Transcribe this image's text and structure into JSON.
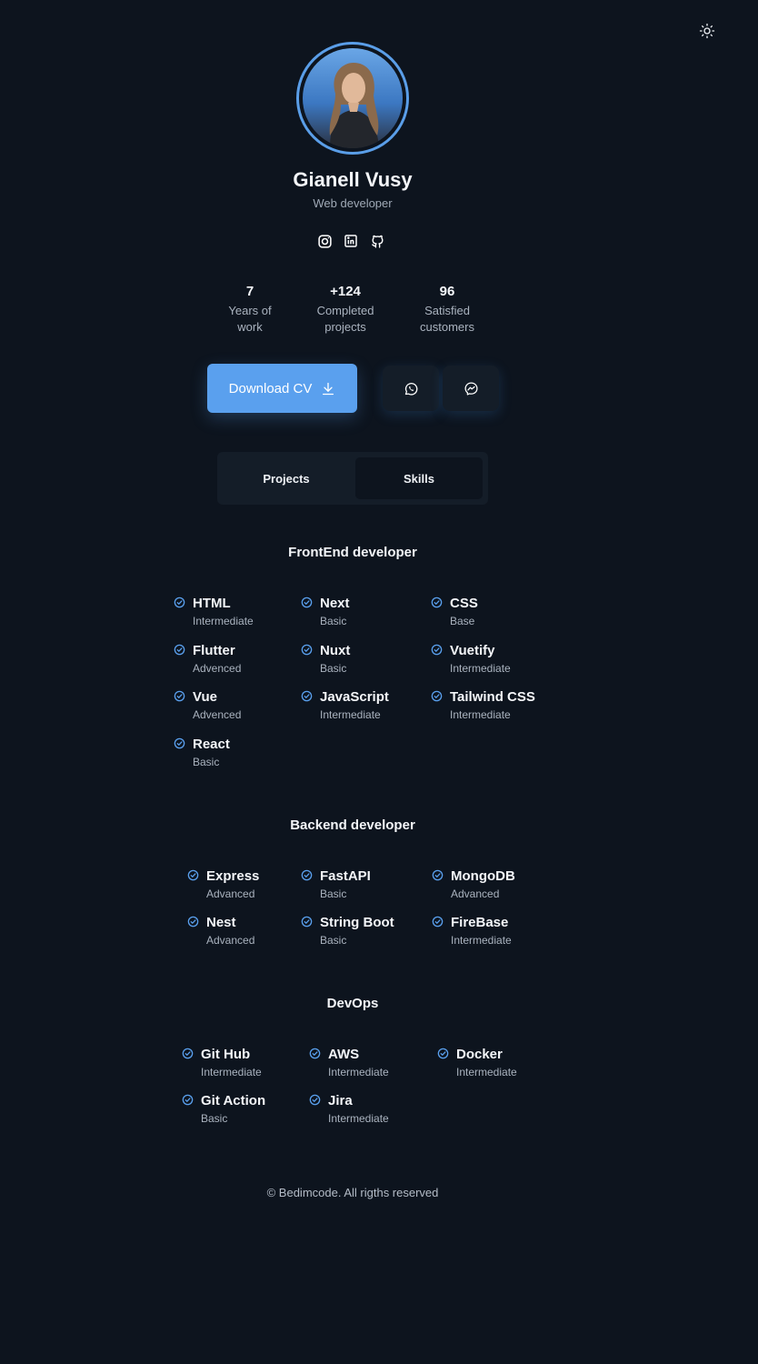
{
  "profile": {
    "name": "Gianell Vusy",
    "role": "Web developer",
    "photo_alt": "profile photo"
  },
  "socials": [
    {
      "icon": "instagram-icon"
    },
    {
      "icon": "linkedin-icon"
    },
    {
      "icon": "github-icon"
    }
  ],
  "stats": [
    {
      "value": "7",
      "label_line1": "Years of",
      "label_line2": "work"
    },
    {
      "value": "+124",
      "label_line1": "Completed",
      "label_line2": "projects"
    },
    {
      "value": "96",
      "label_line1": "Satisfied",
      "label_line2": "customers"
    }
  ],
  "actions": {
    "download_label": "Download CV",
    "download_icon": "download-icon",
    "whatsapp_icon": "whatsapp-icon",
    "messenger_icon": "messenger-icon"
  },
  "tabs": [
    {
      "label": "Projects",
      "active": false
    },
    {
      "label": "Skills",
      "active": true
    }
  ],
  "skills": {
    "frontend": {
      "title": "FrontEnd developer",
      "items": [
        {
          "name": "HTML",
          "level": "Intermediate"
        },
        {
          "name": "Next",
          "level": "Basic"
        },
        {
          "name": "CSS",
          "level": "Base"
        },
        {
          "name": "Flutter",
          "level": "Advenced"
        },
        {
          "name": "Nuxt",
          "level": "Basic"
        },
        {
          "name": "Vuetify",
          "level": "Intermediate"
        },
        {
          "name": "Vue",
          "level": "Advenced"
        },
        {
          "name": "JavaScript",
          "level": "Intermediate"
        },
        {
          "name": "Tailwind CSS",
          "level": "Intermediate"
        },
        {
          "name": "React",
          "level": "Basic"
        }
      ]
    },
    "backend": {
      "title": "Backend developer",
      "items": [
        {
          "name": "Express",
          "level": "Advanced"
        },
        {
          "name": "FastAPI",
          "level": "Basic"
        },
        {
          "name": "MongoDB",
          "level": "Advanced"
        },
        {
          "name": "Nest",
          "level": "Advanced"
        },
        {
          "name": "String Boot",
          "level": "Basic"
        },
        {
          "name": "FireBase",
          "level": "Intermediate"
        }
      ]
    },
    "devops": {
      "title": "DevOps",
      "items": [
        {
          "name": "Git Hub",
          "level": "Intermediate"
        },
        {
          "name": "AWS",
          "level": "Intermediate"
        },
        {
          "name": "Docker",
          "level": "Intermediate"
        },
        {
          "name": "Git Action",
          "level": "Basic"
        },
        {
          "name": "Jira",
          "level": "Intermediate"
        }
      ]
    }
  },
  "footer": {
    "text": "© Bedimcode. All rigths reserved"
  },
  "colors": {
    "background": "#0d141e",
    "accent": "#5aa0ee",
    "card": "#141d28"
  }
}
